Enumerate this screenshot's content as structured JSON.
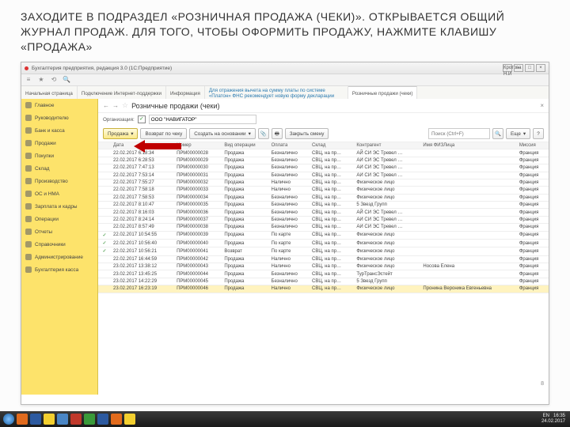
{
  "slide": {
    "title": "ЗАХОДИТЕ В ПОДРАЗДЕЛ «РОЗНИЧНАЯ ПРОДАЖА (ЧЕКИ)». ОТКРЫВАЕТСЯ ОБЩИЙ ЖУРНАЛ ПРОДАЖ. ДЛЯ ТОГО, ЧТОБЫ ОФОРМИТЬ ПРОДАЖУ, НАЖМИТЕ КЛАВИШУ «ПРОДАЖА»",
    "number": "8"
  },
  "chrome": {
    "title": "Бухгалтерия предприятия, редакция 3.0  (1С:Предприятие)",
    "user": "Кротова Н.И"
  },
  "tabs": {
    "items": [
      "Начальная страница",
      "Подключение Интернет-поддержки",
      "Информация"
    ],
    "info": "Для отражения вычета на сумму платы по системе «Платон» ФНС рекомендует новую форму декларации",
    "active": "Розничные продажи (чеки)"
  },
  "sidebar": {
    "items": [
      {
        "label": "Главное"
      },
      {
        "label": "Руководителю"
      },
      {
        "label": "Банк и касса"
      },
      {
        "label": "Продажи"
      },
      {
        "label": "Покупки"
      },
      {
        "label": "Склад"
      },
      {
        "label": "Производство"
      },
      {
        "label": "ОС и НМА"
      },
      {
        "label": "Зарплата и кадры"
      },
      {
        "label": "Операции"
      },
      {
        "label": "Отчеты"
      },
      {
        "label": "Справочники"
      },
      {
        "label": "Администрирование"
      },
      {
        "label": "Бухгалтерия касса"
      }
    ]
  },
  "page": {
    "title": "Розничные продажи (чеки)",
    "org_label": "Организация:",
    "org_value": "ООО \"НАВИГАТОР\"",
    "buttons": {
      "sale": "Продажа",
      "return": "Возврат по чеку",
      "create_on": "Создать на основании",
      "close_shift": "Закрыть смену",
      "more": "Еще"
    },
    "search_ph": "Поиск (Ctrl+F)"
  },
  "grid": {
    "cols": [
      "",
      "Дата",
      "Номер",
      "Вид операции",
      "Оплата",
      "Склад",
      "Контрагент",
      "Имя ФИЗЛица",
      "Миссия"
    ],
    "rows": [
      {
        "ck": "",
        "d": "22.02.2017 6:18:34",
        "n": "ПРМ00000028",
        "op": "Продажа",
        "pay": "Безналично",
        "wh": "СВЦ, на пр…",
        "ctr": "АЙ СИ ЭС Тревел …",
        "fio": "",
        "mis": "Франция"
      },
      {
        "ck": "",
        "d": "22.02.2017 6:28:53",
        "n": "ПРМ00000029",
        "op": "Продажа",
        "pay": "Безналично",
        "wh": "СВЦ, на пр…",
        "ctr": "АЙ СИ ЭС Тревел …",
        "fio": "",
        "mis": "Франция"
      },
      {
        "ck": "",
        "d": "22.02.2017 7:47:13",
        "n": "ПРМ00000030",
        "op": "Продажа",
        "pay": "Безналично",
        "wh": "СВЦ, на пр…",
        "ctr": "АЙ СИ ЭС Тревел …",
        "fio": "",
        "mis": "Франция"
      },
      {
        "ck": "",
        "d": "22.02.2017 7:53:14",
        "n": "ПРМ00000031",
        "op": "Продажа",
        "pay": "Безналично",
        "wh": "СВЦ, на пр…",
        "ctr": "АЙ СИ ЭС Тревел …",
        "fio": "",
        "mis": "Франция"
      },
      {
        "ck": "",
        "d": "22.02.2017 7:55:27",
        "n": "ПРМ00000032",
        "op": "Продажа",
        "pay": "Налично",
        "wh": "СВЦ, на пр…",
        "ctr": "Физическое лицо",
        "fio": "",
        "mis": "Франция"
      },
      {
        "ck": "",
        "d": "22.02.2017 7:58:18",
        "n": "ПРМ00000033",
        "op": "Продажа",
        "pay": "Налично",
        "wh": "СВЦ, на пр…",
        "ctr": "Физическое лицо",
        "fio": "",
        "mis": "Франция"
      },
      {
        "ck": "",
        "d": "22.02.2017 7:58:53",
        "n": "ПРМ00000034",
        "op": "Продажа",
        "pay": "Безналично",
        "wh": "СВЦ, на пр…",
        "ctr": "Физическое лицо",
        "fio": "",
        "mis": "Франция"
      },
      {
        "ck": "",
        "d": "22.02.2017 8:10:47",
        "n": "ПРМ00000035",
        "op": "Продажа",
        "pay": "Безналично",
        "wh": "СВЦ, на пр…",
        "ctr": "5 Звезд Групп",
        "fio": "",
        "mis": "Франция"
      },
      {
        "ck": "",
        "d": "22.02.2017 8:16:03",
        "n": "ПРМ00000036",
        "op": "Продажа",
        "pay": "Безналично",
        "wh": "СВЦ, на пр…",
        "ctr": "АЙ СИ ЭС Тревел …",
        "fio": "",
        "mis": "Франция"
      },
      {
        "ck": "",
        "d": "22.02.2017 8:24:14",
        "n": "ПРМ00000037",
        "op": "Продажа",
        "pay": "Безналично",
        "wh": "СВЦ, на пр…",
        "ctr": "АЙ СИ ЭС Тревел …",
        "fio": "",
        "mis": "Франция"
      },
      {
        "ck": "",
        "d": "22.02.2017 8:57:49",
        "n": "ПРМ00000038",
        "op": "Продажа",
        "pay": "Безналично",
        "wh": "СВЦ, на пр…",
        "ctr": "АЙ СИ ЭС Тревел …",
        "fio": "",
        "mis": "Франция"
      },
      {
        "ck": "✓",
        "d": "22.02.2017 10:54:55",
        "n": "ПРМ00000039",
        "op": "Продажа",
        "pay": "По карте",
        "wh": "СВЦ, на пр…",
        "ctr": "Физическое лицо",
        "fio": "",
        "mis": "Франция"
      },
      {
        "ck": "✓",
        "d": "22.02.2017 10:56:40",
        "n": "ПРМ00000040",
        "op": "Продажа",
        "pay": "По карте",
        "wh": "СВЦ, на пр…",
        "ctr": "Физическое лицо",
        "fio": "",
        "mis": "Франция"
      },
      {
        "ck": "✓",
        "d": "22.02.2017 10:56:21",
        "n": "ПРМ00000041",
        "op": "Возврат",
        "pay": "По карте",
        "wh": "СВЦ, на пр…",
        "ctr": "Физическое лицо",
        "fio": "",
        "mis": "Франция"
      },
      {
        "ck": "",
        "d": "22.02.2017 16:44:59",
        "n": "ПРМ00000042",
        "op": "Продажа",
        "pay": "Налично",
        "wh": "СВЦ, на пр…",
        "ctr": "Физическое лицо",
        "fio": "",
        "mis": "Франция"
      },
      {
        "ck": "",
        "d": "23.02.2017 13:38:12",
        "n": "ПРМ00000043",
        "op": "Продажа",
        "pay": "Налично",
        "wh": "СВЦ, на пр…",
        "ctr": "Физическое лицо",
        "fio": "Носова Елена",
        "mis": "Франция"
      },
      {
        "ck": "",
        "d": "23.02.2017 13:45:25",
        "n": "ПРМ00000044",
        "op": "Продажа",
        "pay": "Безналично",
        "wh": "СВЦ, на пр…",
        "ctr": "ТурТрансЭстейт",
        "fio": "",
        "mis": "Франция"
      },
      {
        "ck": "",
        "d": "23.02.2017 14:22:29",
        "n": "ПРМ00000045",
        "op": "Продажа",
        "pay": "Безналично",
        "wh": "СВЦ, на пр…",
        "ctr": "5 Звезд Групп",
        "fio": "",
        "mis": "Франция"
      },
      {
        "ck": "",
        "hl": true,
        "d": "23.02.2017 16:23:19",
        "n": "ПРМ00000046",
        "op": "Продажа",
        "pay": "Налично",
        "wh": "СВЦ, на пр…",
        "ctr": "Физическое лицо",
        "fio": "Пронина Вероника Евгеньевна",
        "mis": "Франция"
      }
    ]
  },
  "clock": {
    "time": "16:35",
    "date": "24.02.2017",
    "lang": "EN"
  }
}
